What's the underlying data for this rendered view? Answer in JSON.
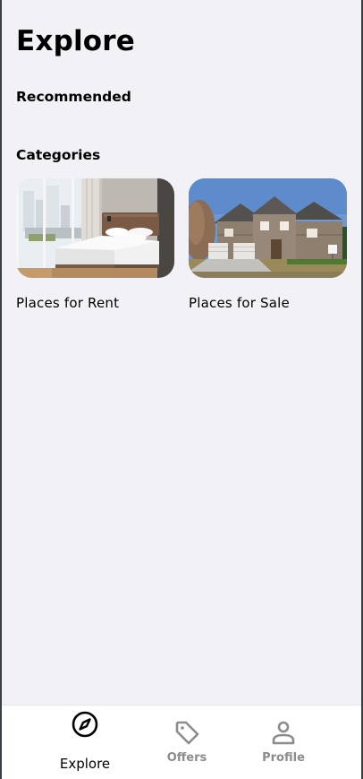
{
  "page": {
    "title": "Explore"
  },
  "sections": {
    "recommended_title": "Recommended",
    "categories_title": "Categories"
  },
  "categories": [
    {
      "label": "Places for Rent",
      "image": "bedroom-photo"
    },
    {
      "label": "Places for Sale",
      "image": "house-photo"
    }
  ],
  "tabbar": {
    "items": [
      {
        "label": "Explore",
        "icon": "compass-icon",
        "active": true
      },
      {
        "label": "Offers",
        "icon": "tag-icon",
        "active": false
      },
      {
        "label": "Profile",
        "icon": "person-icon",
        "active": false
      }
    ]
  },
  "colors": {
    "background": "#f2f2f6",
    "text": "#000000",
    "inactive_tab": "#8c8c8c",
    "tabbar_bg": "#ffffff"
  }
}
